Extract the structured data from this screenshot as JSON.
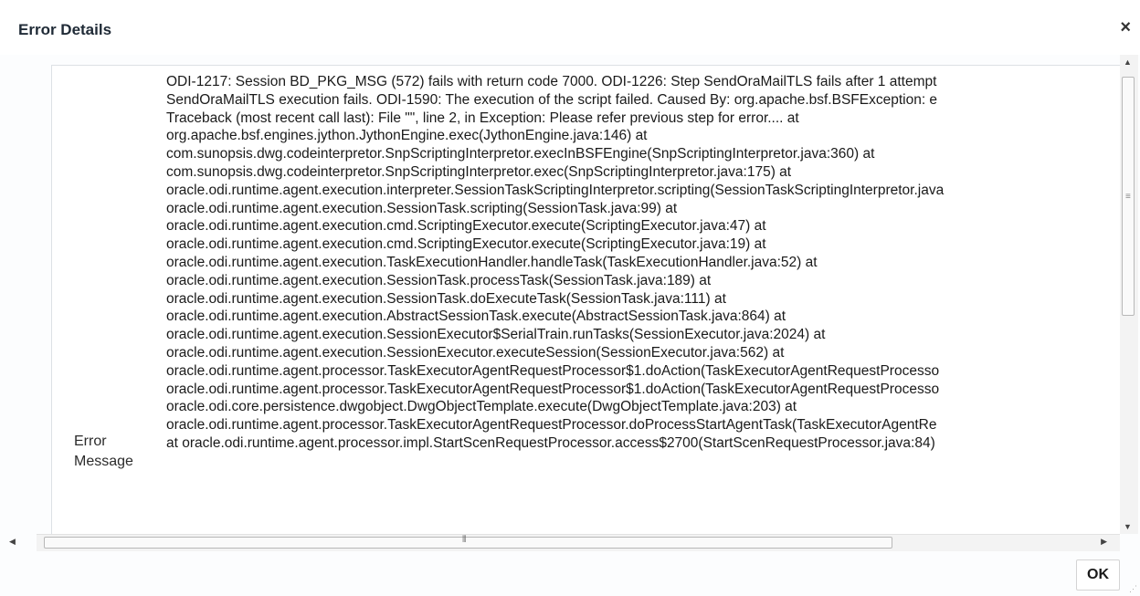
{
  "dialog": {
    "title": "Error Details",
    "close_icon": "×",
    "ok_label": "OK"
  },
  "field": {
    "label": "Error\nMessage"
  },
  "error_message": "ODI-1217: Session BD_PKG_MSG (572) fails with return code 7000. ODI-1226: Step SendOraMailTLS fails after 1 attempt\nSendOraMailTLS execution fails. ODI-1590: The execution of the script failed. Caused By: org.apache.bsf.BSFException: e\nTraceback (most recent call last): File \"\", line 2, in Exception: Please refer previous step for error.... at\norg.apache.bsf.engines.jython.JythonEngine.exec(JythonEngine.java:146) at\ncom.sunopsis.dwg.codeinterpretor.SnpScriptingInterpretor.execInBSFEngine(SnpScriptingInterpretor.java:360) at\ncom.sunopsis.dwg.codeinterpretor.SnpScriptingInterpretor.exec(SnpScriptingInterpretor.java:175) at\noracle.odi.runtime.agent.execution.interpreter.SessionTaskScriptingInterpretor.scripting(SessionTaskScriptingInterpretor.java\noracle.odi.runtime.agent.execution.SessionTask.scripting(SessionTask.java:99) at\noracle.odi.runtime.agent.execution.cmd.ScriptingExecutor.execute(ScriptingExecutor.java:47) at\noracle.odi.runtime.agent.execution.cmd.ScriptingExecutor.execute(ScriptingExecutor.java:19) at\noracle.odi.runtime.agent.execution.TaskExecutionHandler.handleTask(TaskExecutionHandler.java:52) at\noracle.odi.runtime.agent.execution.SessionTask.processTask(SessionTask.java:189) at\noracle.odi.runtime.agent.execution.SessionTask.doExecuteTask(SessionTask.java:111) at\noracle.odi.runtime.agent.execution.AbstractSessionTask.execute(AbstractSessionTask.java:864) at\noracle.odi.runtime.agent.execution.SessionExecutor$SerialTrain.runTasks(SessionExecutor.java:2024) at\noracle.odi.runtime.agent.execution.SessionExecutor.executeSession(SessionExecutor.java:562) at\noracle.odi.runtime.agent.processor.TaskExecutorAgentRequestProcessor$1.doAction(TaskExecutorAgentRequestProcesso\noracle.odi.runtime.agent.processor.TaskExecutorAgentRequestProcessor$1.doAction(TaskExecutorAgentRequestProcesso\noracle.odi.core.persistence.dwgobject.DwgObjectTemplate.execute(DwgObjectTemplate.java:203) at\noracle.odi.runtime.agent.processor.TaskExecutorAgentRequestProcessor.doProcessStartAgentTask(TaskExecutorAgentRe\nat oracle.odi.runtime.agent.processor.impl.StartScenRequestProcessor.access$2700(StartScenRequestProcessor.java:84)",
  "scrollbars": {
    "vertical_grip": "≡",
    "horizontal_grip": "⦀",
    "up_arrow": "▲",
    "down_arrow": "▼",
    "left_arrow": "◀",
    "right_arrow": "▶"
  },
  "resize_grip": "⋰"
}
